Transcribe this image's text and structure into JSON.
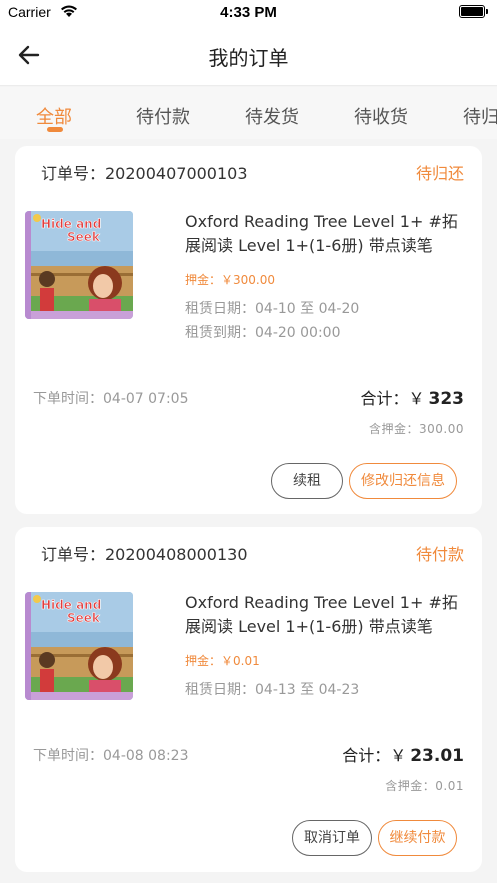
{
  "status_bar": {
    "carrier": "Carrier",
    "time": "4:33 PM"
  },
  "nav": {
    "title": "我的订单"
  },
  "tabs": [
    {
      "label": "全部",
      "active": true
    },
    {
      "label": "待付款"
    },
    {
      "label": "待发货"
    },
    {
      "label": "待收货"
    },
    {
      "label": "待归还"
    }
  ],
  "colors": {
    "accent": "#f08a3c",
    "muted": "#999999",
    "background": "#f4f4f4"
  },
  "orders": [
    {
      "order_no": "订单号：20200407000103",
      "status": "待归还",
      "cover_text_line1": "Hide and",
      "cover_text_line2": "Seek",
      "title": "Oxford Reading Tree Level 1+ #拓展阅读 Level 1+(1-6册) 带点读笔",
      "deposit": "押金：￥300.00",
      "rent_dates": "租赁日期：04-10 至 04-20",
      "due": "租赁到期：04-20 00:00",
      "order_time": "下单时间：04-07 07:05",
      "total_label": "合计：￥",
      "total_amount": "323",
      "deposit_sub": "含押金：300.00",
      "buttons": {
        "left": "续租",
        "right": "修改归还信息"
      }
    },
    {
      "order_no": "订单号：20200408000130",
      "status": "待付款",
      "cover_text_line1": "Hide and",
      "cover_text_line2": "Seek",
      "title": "Oxford Reading Tree Level 1+ #拓展阅读 Level 1+(1-6册) 带点读笔",
      "deposit": "押金：￥0.01",
      "rent_dates": "租赁日期：04-13 至 04-23",
      "order_time": "下单时间：04-08 08:23",
      "total_label": "合计：￥",
      "total_amount": "23.01",
      "deposit_sub": "含押金：0.01",
      "buttons": {
        "left": "取消订单",
        "right": "继续付款"
      }
    }
  ]
}
